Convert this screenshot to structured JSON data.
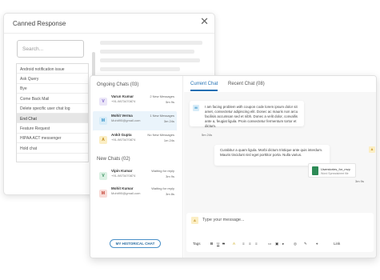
{
  "canned": {
    "title": "Canned Response",
    "close_glyph": "✕",
    "search_placeholder": "Search...",
    "items": [
      "Android notification issue",
      "Ask Query",
      "Bye",
      "Come Back Mail",
      "Delete specific user chat log",
      "End Chat",
      "Feature Request",
      "HIPAA ACT messenger",
      "Hold chat"
    ],
    "active_index": 5
  },
  "ongoing": {
    "title": "Ongoing Chats (03)",
    "chats": [
      {
        "initial": "V",
        "name": "Varun Kumar",
        "phone": "+91-9873470874",
        "status": "2 New Messages",
        "time": "5m 9s",
        "color": "#7b61c9",
        "bg": "#ebe6f8"
      },
      {
        "initial": "M",
        "name": "Mohit Verma",
        "phone": "Mohit90@gmail.com",
        "status": "1 New Messages",
        "time": "3m 24s",
        "color": "#2d8fc8",
        "bg": "#d7ecf8"
      },
      {
        "initial": "A",
        "name": "Ankit Gupta",
        "phone": "+91-9873470874",
        "status": "No New Messages",
        "time": "1m 24s",
        "color": "#c08a17",
        "bg": "#fbeec4"
      }
    ]
  },
  "newchats": {
    "title": "New Chats (02)",
    "chats": [
      {
        "initial": "V",
        "name": "Vipin Kumar",
        "phone": "+91-9873470874",
        "status": "Waiting for reply",
        "time": "3m 9s",
        "color": "#2e8b57",
        "bg": "#dcf1e4"
      },
      {
        "initial": "M",
        "name": "Mohit Kumar",
        "phone": "Mohit90@gmail.com",
        "status": "Waiting for reply",
        "time": "3m 8s",
        "color": "#c0392b",
        "bg": "#f8dcd8"
      }
    ]
  },
  "history_button": "MY HISTORICAL CHAT",
  "tabs": [
    "Current Chat",
    "Recent Chat (08)"
  ],
  "messages": {
    "incoming": {
      "avatar": "M",
      "text": "I am facing problem with coupon code lorem ipsum dolor sit amet, consectetur adipiscing elit. Donec ac mauris non arcu facilisis accumsan sed et nibh. Donec a velit dolor, convallis ante a, feugiat ligula. Proin consectetur fermentum tortor et dictum.",
      "time": "5m 24s"
    },
    "outgoing": {
      "avatar": "A",
      "text": "Curabitur a quam ligula. Morbi dictum tristique ante quis interdum. Mauris tincidunt nisl eget porttitor porta. Nulla varius.",
      "file_name": "Userstories_for_mvp",
      "file_meta": "Word Spreadsheet file",
      "time": "3m 9s"
    }
  },
  "composer": {
    "avatar": "A",
    "placeholder": "Type your message...",
    "tools": [
      "Tags",
      "B",
      "U",
      "S",
      "A",
      "≡",
      "≡",
      "≡",
      "▭",
      "▣",
      "▸",
      "◎",
      "✎",
      "⌖",
      "Link"
    ]
  }
}
